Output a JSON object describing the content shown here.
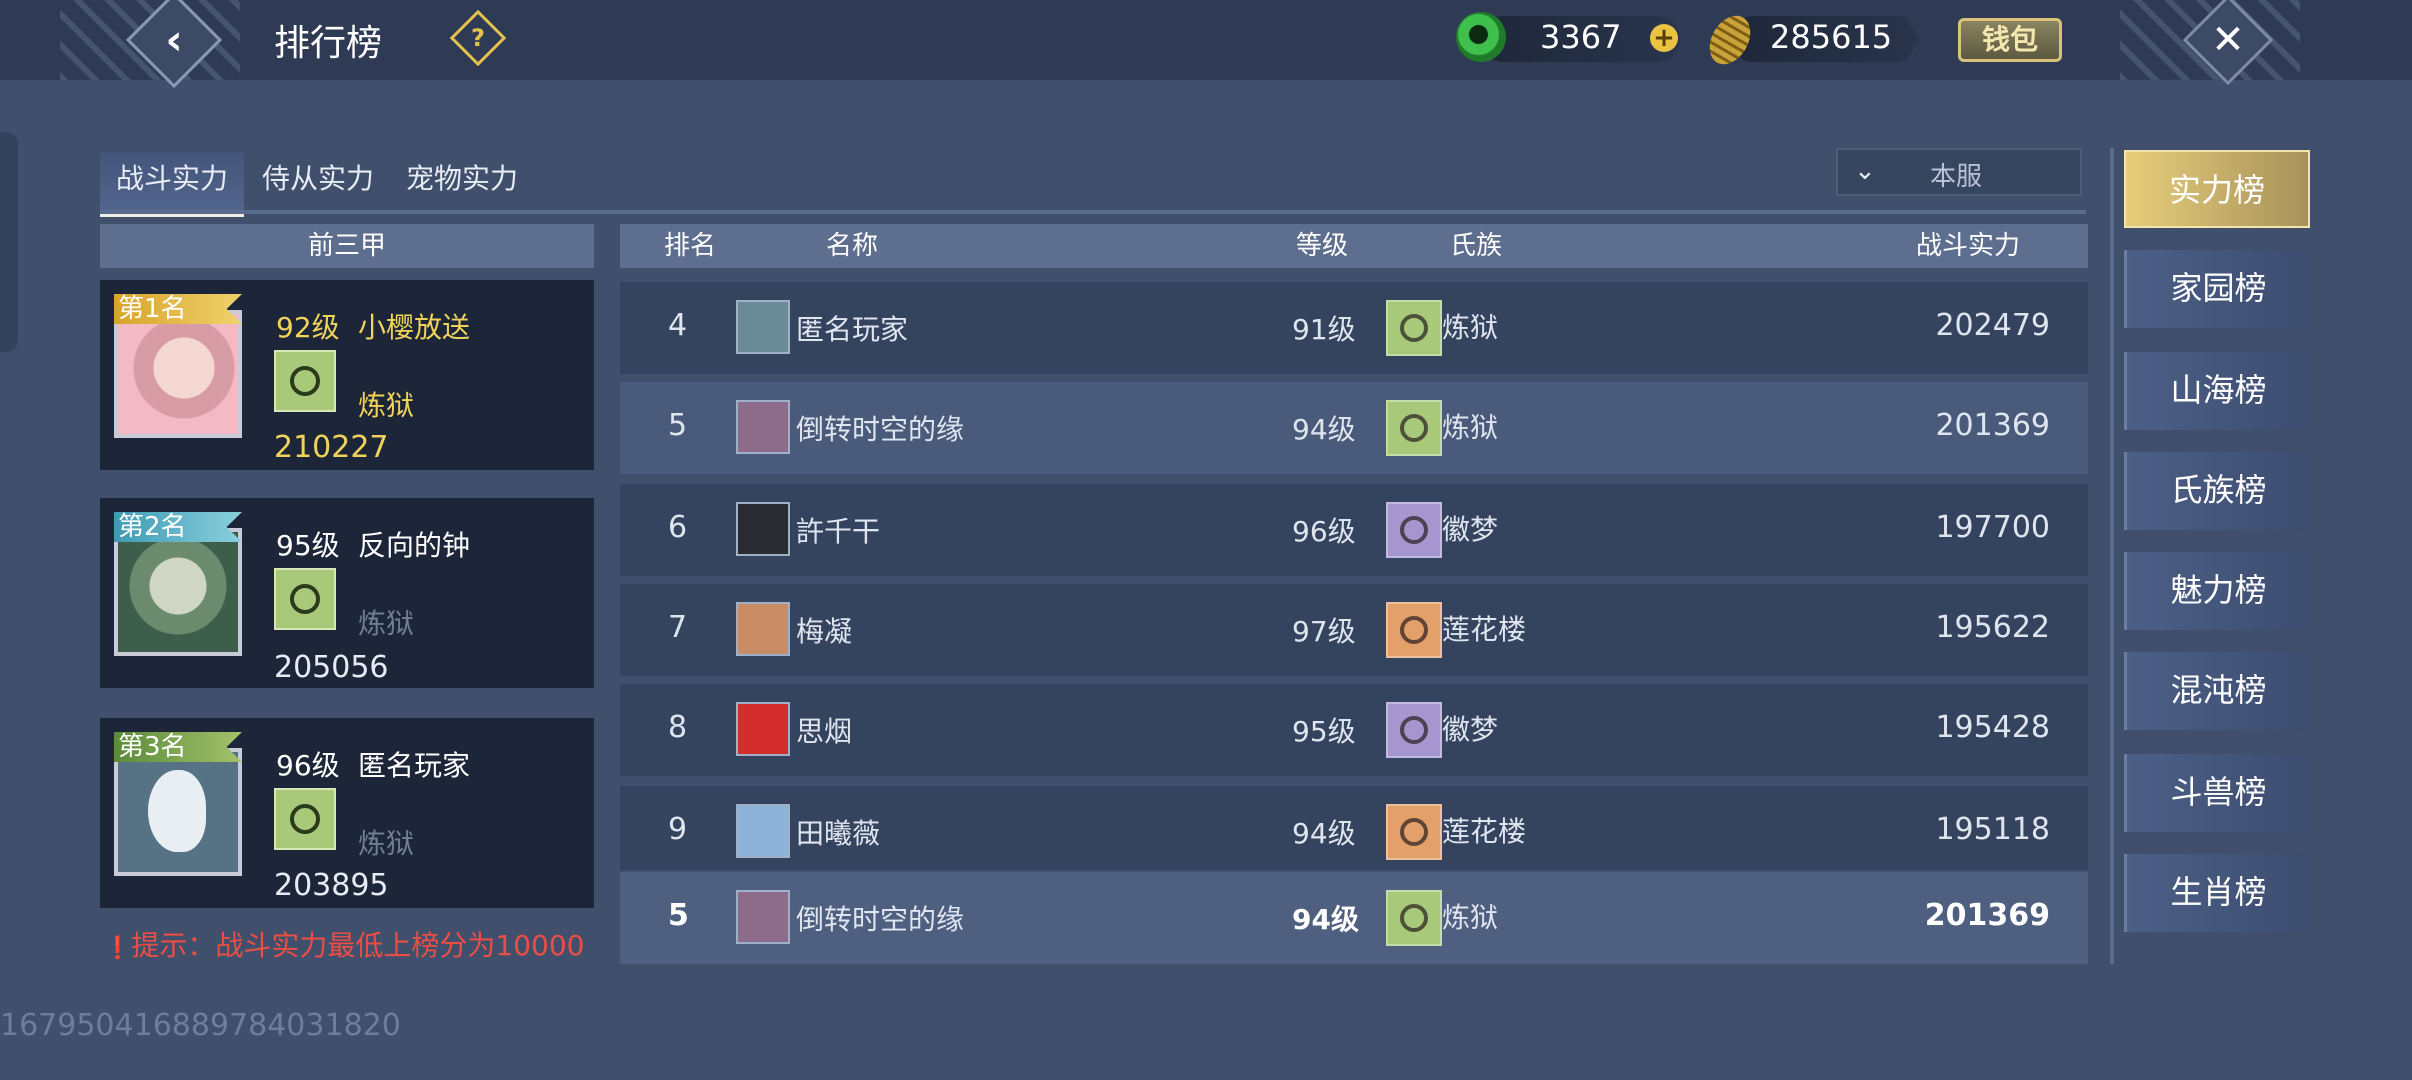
{
  "header": {
    "title": "排行榜",
    "help_icon": "question-icon",
    "jade": "3367",
    "gold": "285615",
    "wallet_label": "钱包"
  },
  "tabs": [
    "战斗实力",
    "侍从实力",
    "宠物实力"
  ],
  "server_select": "本服",
  "top3": {
    "header": "前三甲",
    "items": [
      {
        "badge": "第1名",
        "level": "92级",
        "name": "小樱放送",
        "clan": "炼狱",
        "power": "210227"
      },
      {
        "badge": "第2名",
        "level": "95级",
        "name": "反向的钟",
        "clan": "炼狱",
        "power": "205056"
      },
      {
        "badge": "第3名",
        "level": "96级",
        "name": "匿名玩家",
        "clan": "炼狱",
        "power": "203895"
      }
    ]
  },
  "hint": "提示：战斗实力最低上榜分为10000",
  "uid": "1679504168897840318​20",
  "table": {
    "columns": {
      "rank": "排名",
      "name": "名称",
      "level": "等级",
      "clan": "氏族",
      "power": "战斗实力"
    },
    "rows": [
      {
        "rank": "4",
        "name": "匿名玩家",
        "level": "91级",
        "clan": "炼狱",
        "power": "202479"
      },
      {
        "rank": "5",
        "name": "倒转时空的缘",
        "level": "94级",
        "clan": "炼狱",
        "power": "201369"
      },
      {
        "rank": "6",
        "name": "許千干",
        "level": "96级",
        "clan": "徽梦",
        "power": "197700"
      },
      {
        "rank": "7",
        "name": "梅凝",
        "level": "97级",
        "clan": "莲花楼",
        "power": "195622"
      },
      {
        "rank": "8",
        "name": "思烟",
        "level": "95级",
        "clan": "徽梦",
        "power": "195428"
      },
      {
        "rank": "9",
        "name": "田曦薇",
        "level": "94级",
        "clan": "莲花楼",
        "power": "195118"
      }
    ],
    "my_row": {
      "rank": "5",
      "name": "倒转时空的缘",
      "level": "94级",
      "clan": "炼狱",
      "power": "201369"
    }
  },
  "nav": [
    "实力榜",
    "家园榜",
    "山海榜",
    "氏族榜",
    "魅力榜",
    "混沌榜",
    "斗兽榜",
    "生肖榜"
  ]
}
